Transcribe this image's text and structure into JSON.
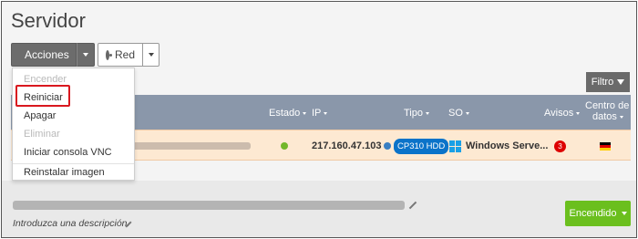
{
  "page": {
    "title": "Servidor"
  },
  "toolbar": {
    "actions_label": "Acciones",
    "network_label": "Red",
    "filter_label": "Filtro"
  },
  "actions_menu": {
    "items": [
      {
        "label": "Encender",
        "disabled": true
      },
      {
        "label": "Reiniciar",
        "disabled": false,
        "highlighted": true
      },
      {
        "label": "Apagar",
        "disabled": false
      },
      {
        "label": "Eliminar",
        "disabled": true
      },
      {
        "label": "Iniciar consola VNC",
        "disabled": false
      },
      {
        "label": "Reinstalar imagen",
        "disabled": false
      }
    ]
  },
  "table": {
    "headers": {
      "estado": "Estado",
      "ip": "IP",
      "tipo": "Tipo",
      "so": "SO",
      "avisos": "Avisos",
      "centro_l1": "Centro de",
      "centro_l2": "datos"
    },
    "rows": [
      {
        "status": "running",
        "ip": "217.160.47.103",
        "tipo": "CP310 HDD",
        "so": "Windows Serve...",
        "avisos": "3",
        "flag": "de"
      }
    ]
  },
  "server": {
    "description_placeholder": "Introduzca una descripción.",
    "power_label": "Encendido"
  },
  "colors": {
    "status_running": "#72b72a",
    "power_on": "#6bbf1e",
    "highlight": "#d9181f",
    "type_badge": "#0b73c9",
    "header_bg": "#8a97aa",
    "row_bg": "#fde9d2"
  },
  "icons": {
    "actions": "list-icon",
    "network": "eye-icon",
    "filter": "funnel-icon",
    "os": "windows-icon",
    "datacenter": "flag-germany-icon",
    "edit": "pencil-icon"
  }
}
